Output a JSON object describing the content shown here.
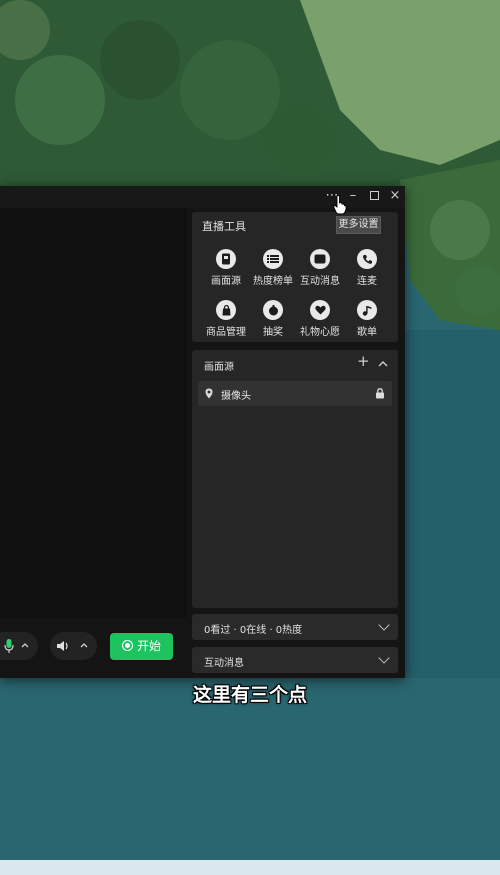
{
  "colors": {
    "window_bg": "#141414",
    "panel_bg": "#262626",
    "accent_green": "#1ec35f",
    "forest": "#2f5a36",
    "grass": "#7aa06c",
    "lake": "#2a6670"
  },
  "live_tools": {
    "title": "直播工具",
    "more_settings": "更多设置",
    "tools": [
      {
        "label": "画面源",
        "icon": "screen-source-icon"
      },
      {
        "label": "热度榜单",
        "icon": "list-icon"
      },
      {
        "label": "互动消息",
        "icon": "message-icon"
      },
      {
        "label": "连麦",
        "icon": "phone-icon"
      },
      {
        "label": "商品管理",
        "icon": "bag-icon"
      },
      {
        "label": "抽奖",
        "icon": "gift-draw-icon"
      },
      {
        "label": "礼物心愿",
        "icon": "heart-gift-icon"
      },
      {
        "label": "歌单",
        "icon": "music-icon"
      }
    ]
  },
  "source_panel": {
    "title": "画面源",
    "items": [
      {
        "label": "摄像头",
        "icon": "location-pin-icon",
        "locked": true
      }
    ]
  },
  "stats": {
    "label": "0看过 · 0在线 · 0热度"
  },
  "messages": {
    "label": "互动消息"
  },
  "controls": {
    "start_label": "开始"
  },
  "subtitle": "这里有三个点"
}
